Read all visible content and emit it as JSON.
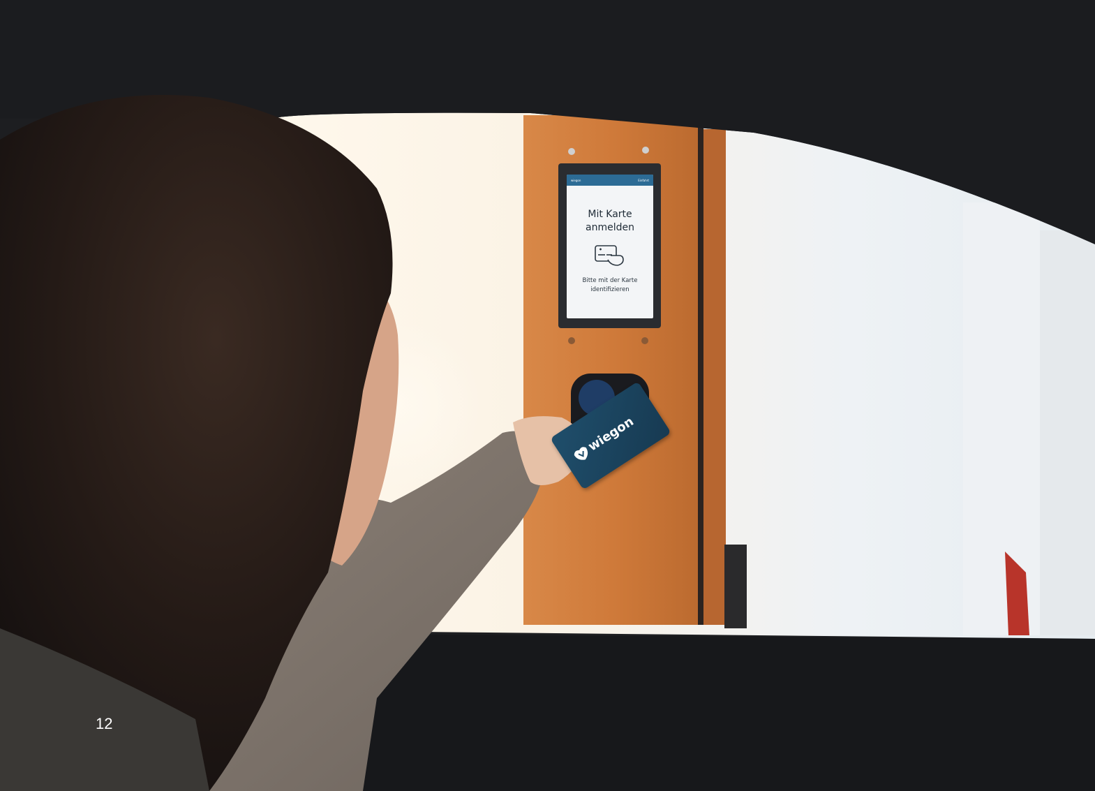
{
  "kiosk_screen": {
    "header_brand": "wiegon",
    "header_action": "Einfahrt",
    "title_line1": "Mit Karte",
    "title_line2": "anmelden",
    "hint_line1": "Bitte mit der Karte",
    "hint_line2": "identifizieren"
  },
  "card": {
    "brand": "wiegon"
  },
  "page": {
    "number": "12"
  },
  "colors": {
    "top_bar": "#2a5f8f",
    "kiosk_orange": "#cf7a3a",
    "card_blue": "#1f4e6b",
    "car_interior": "#1c1d20"
  }
}
